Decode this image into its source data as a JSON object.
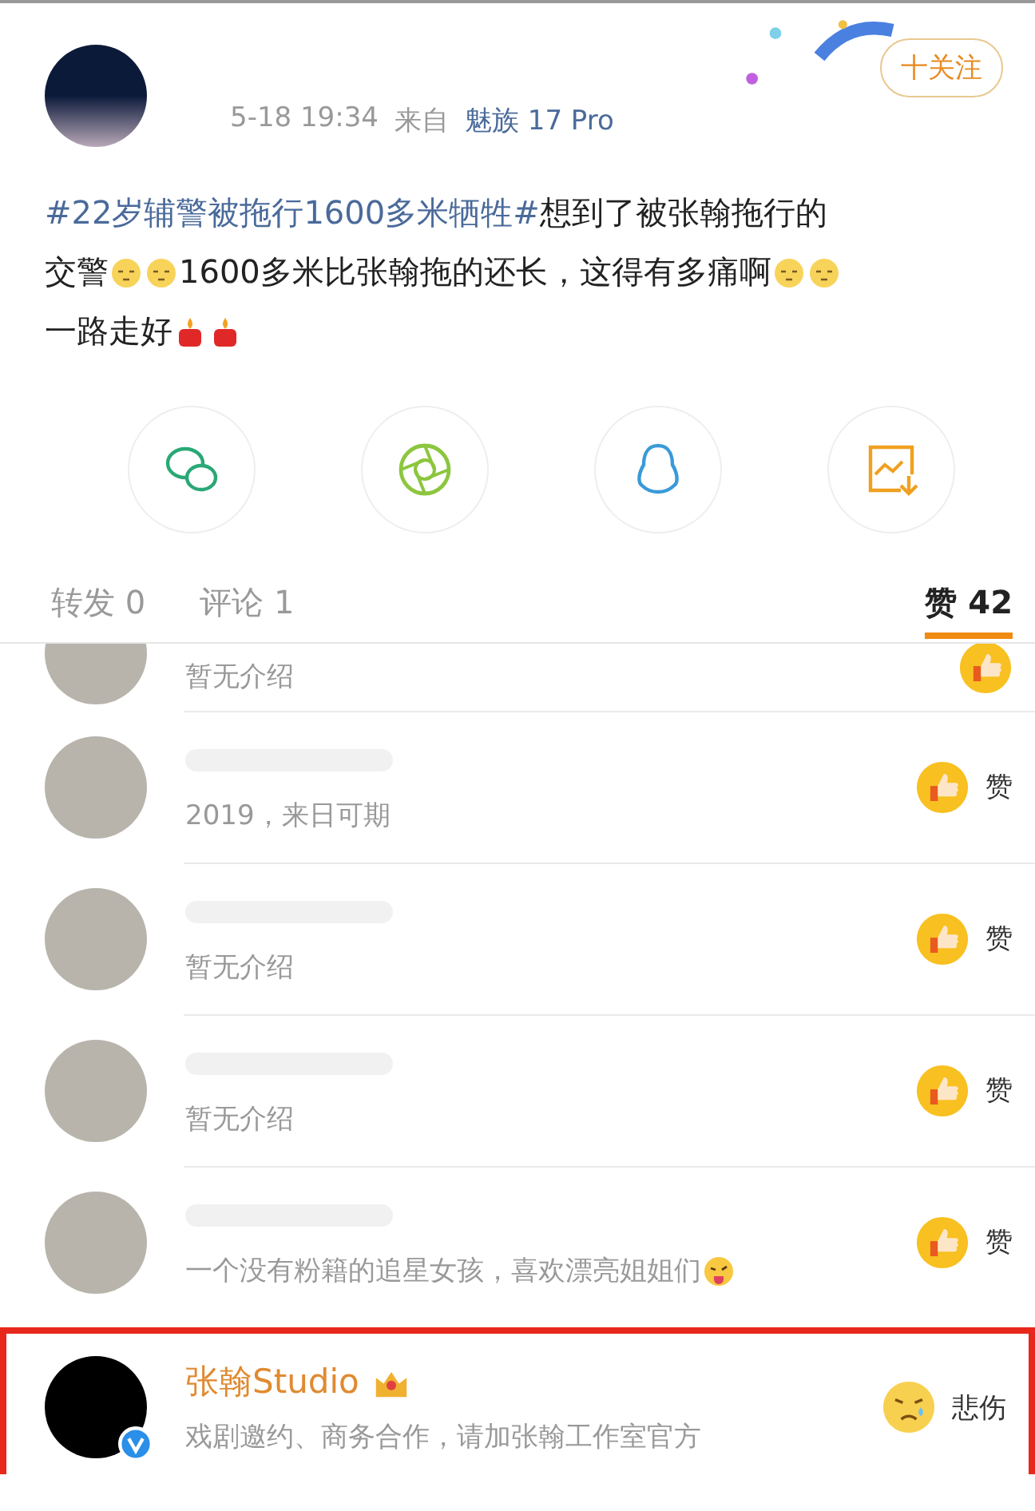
{
  "post": {
    "time": "5-18 19:34",
    "source_prefix": "来自",
    "source": "魅族 17 Pro",
    "follow": "十关注",
    "lines": [
      [
        {
          "kind": "hashtag",
          "text": "#22岁辅警被拖行1600多米牺牲#"
        },
        {
          "kind": "text",
          "text": "想到了被张翰拖行的"
        }
      ],
      [
        {
          "kind": "text",
          "text": "交警"
        },
        {
          "kind": "face"
        },
        {
          "kind": "face"
        },
        {
          "kind": "text",
          "text": "1600多米比张翰拖的还长，这得有多痛啊"
        },
        {
          "kind": "face"
        },
        {
          "kind": "face"
        }
      ],
      [
        {
          "kind": "text",
          "text": "一路走好"
        },
        {
          "kind": "candle"
        },
        {
          "kind": "candle"
        }
      ]
    ]
  },
  "share": [
    {
      "kind": "chat"
    },
    {
      "kind": "aperture"
    },
    {
      "kind": "penguin"
    },
    {
      "kind": "save-image"
    }
  ],
  "tabs": [
    {
      "label": "转发 0",
      "selected": false
    },
    {
      "label": "评论 1",
      "selected": false
    },
    {
      "label": "赞 42",
      "selected": true
    }
  ],
  "likes": [
    {
      "clipped": true,
      "desc": "暂无介绍",
      "kind": "like",
      "highlighted": false,
      "verified": false
    },
    {
      "clipped": false,
      "desc": "2019，来日可期",
      "kind": "like",
      "reaction_label": "赞",
      "highlighted": false,
      "verified": false
    },
    {
      "clipped": false,
      "desc": "暂无介绍",
      "kind": "like",
      "reaction_label": "赞",
      "highlighted": false,
      "verified": false
    },
    {
      "clipped": false,
      "desc": "暂无介绍",
      "kind": "like",
      "reaction_label": "赞",
      "highlighted": false,
      "verified": false
    },
    {
      "clipped": false,
      "desc": "一个没有粉籍的追星女孩，喜欢漂亮姐姐们",
      "tongue_emoji": true,
      "kind": "like",
      "reaction_label": "赞",
      "highlighted": false,
      "verified": false
    },
    {
      "clipped": false,
      "name": "张翰Studio",
      "desc": "戏剧邀约、商务合作，请加张翰工作室官方",
      "kind": "sad",
      "reaction_label": "悲伤",
      "highlighted": true,
      "verified": true
    }
  ]
}
